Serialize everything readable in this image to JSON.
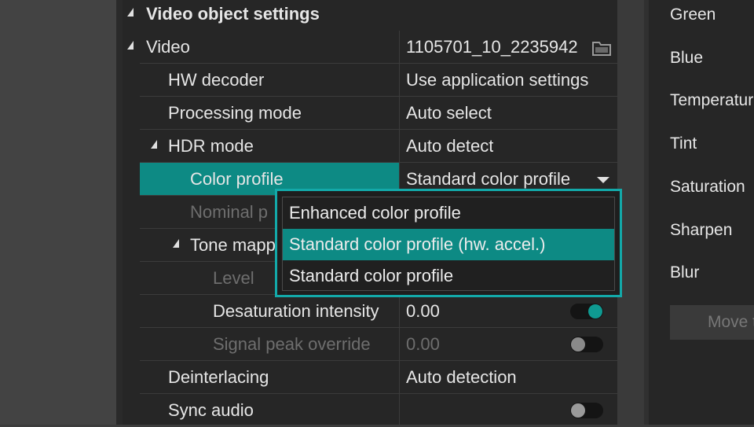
{
  "section": {
    "title": "Video object settings"
  },
  "rows": [
    {
      "label": "Video",
      "value": "1105701_10_2235942"
    },
    {
      "label": "HW decoder",
      "value": "Use application settings"
    },
    {
      "label": "Processing mode",
      "value": "Auto select"
    },
    {
      "label": "HDR mode",
      "value": "Auto detect"
    },
    {
      "label": "Color profile",
      "value": "Standard color profile"
    },
    {
      "label": "Nominal p"
    },
    {
      "label": "Tone mapp"
    },
    {
      "label": "Level"
    },
    {
      "label": "Desaturation intensity",
      "value": "0.00",
      "toggle_on": true
    },
    {
      "label": "Signal peak override",
      "value": "0.00",
      "toggle_on": false
    },
    {
      "label": "Deinterlacing",
      "value": "Auto detection"
    },
    {
      "label": "Sync audio",
      "toggle_on": false
    }
  ],
  "dropdown": {
    "options": [
      "Enhanced color profile",
      "Standard color profile (hw. accel.)",
      "Standard color profile"
    ],
    "selected_index": 1
  },
  "right_panel": {
    "labels": [
      "Green",
      "Blue",
      "Temperatur",
      "Tint",
      "Saturation",
      "Sharpen",
      "Blur"
    ],
    "button_label": "Move t"
  },
  "colors": {
    "accent": "#13a9a9",
    "highlight": "#0d8a84",
    "toggle_on_knob": "#0f9a91"
  },
  "icons": {
    "video_browse": "folder-icon",
    "expand": "triangle-expanded-icon",
    "dropdown": "chevron-down-icon"
  }
}
